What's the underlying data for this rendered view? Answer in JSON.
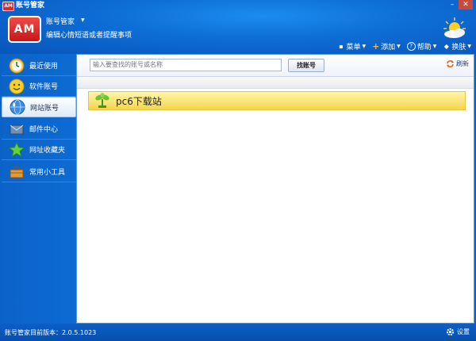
{
  "window": {
    "title": "账号管家",
    "app_icon_text": "AM"
  },
  "header": {
    "logo_text": "AM",
    "user_name": "账号管家",
    "user_signature": "编辑心情短语或者提醒事项"
  },
  "toolbar": {
    "menu_label": "菜单",
    "add_label": "添加",
    "help_label": "帮助",
    "skin_label": "换肤"
  },
  "sidebar": {
    "items": [
      {
        "label": "最近使用",
        "icon": "clock-icon"
      },
      {
        "label": "软件账号",
        "icon": "smiley-icon"
      },
      {
        "label": "网站账号",
        "icon": "globe-icon"
      },
      {
        "label": "邮件中心",
        "icon": "mail-icon"
      },
      {
        "label": "网址收藏夹",
        "icon": "star-icon"
      },
      {
        "label": "常用小工具",
        "icon": "toolbox-icon"
      }
    ],
    "active_index": 2
  },
  "search": {
    "placeholder": "输入要查找的账号或名称",
    "button_label": "找账号"
  },
  "refresh_label": "刷新",
  "list": {
    "rows": [
      {
        "label": "pc6下载站"
      }
    ]
  },
  "status": {
    "version_text": "账号管家目前版本：2.0.5.1023",
    "settings_label": "设置"
  },
  "colors": {
    "brand": "#0a63c9",
    "logo_red": "#e3262b",
    "row_highlight": "#f5d54d"
  }
}
